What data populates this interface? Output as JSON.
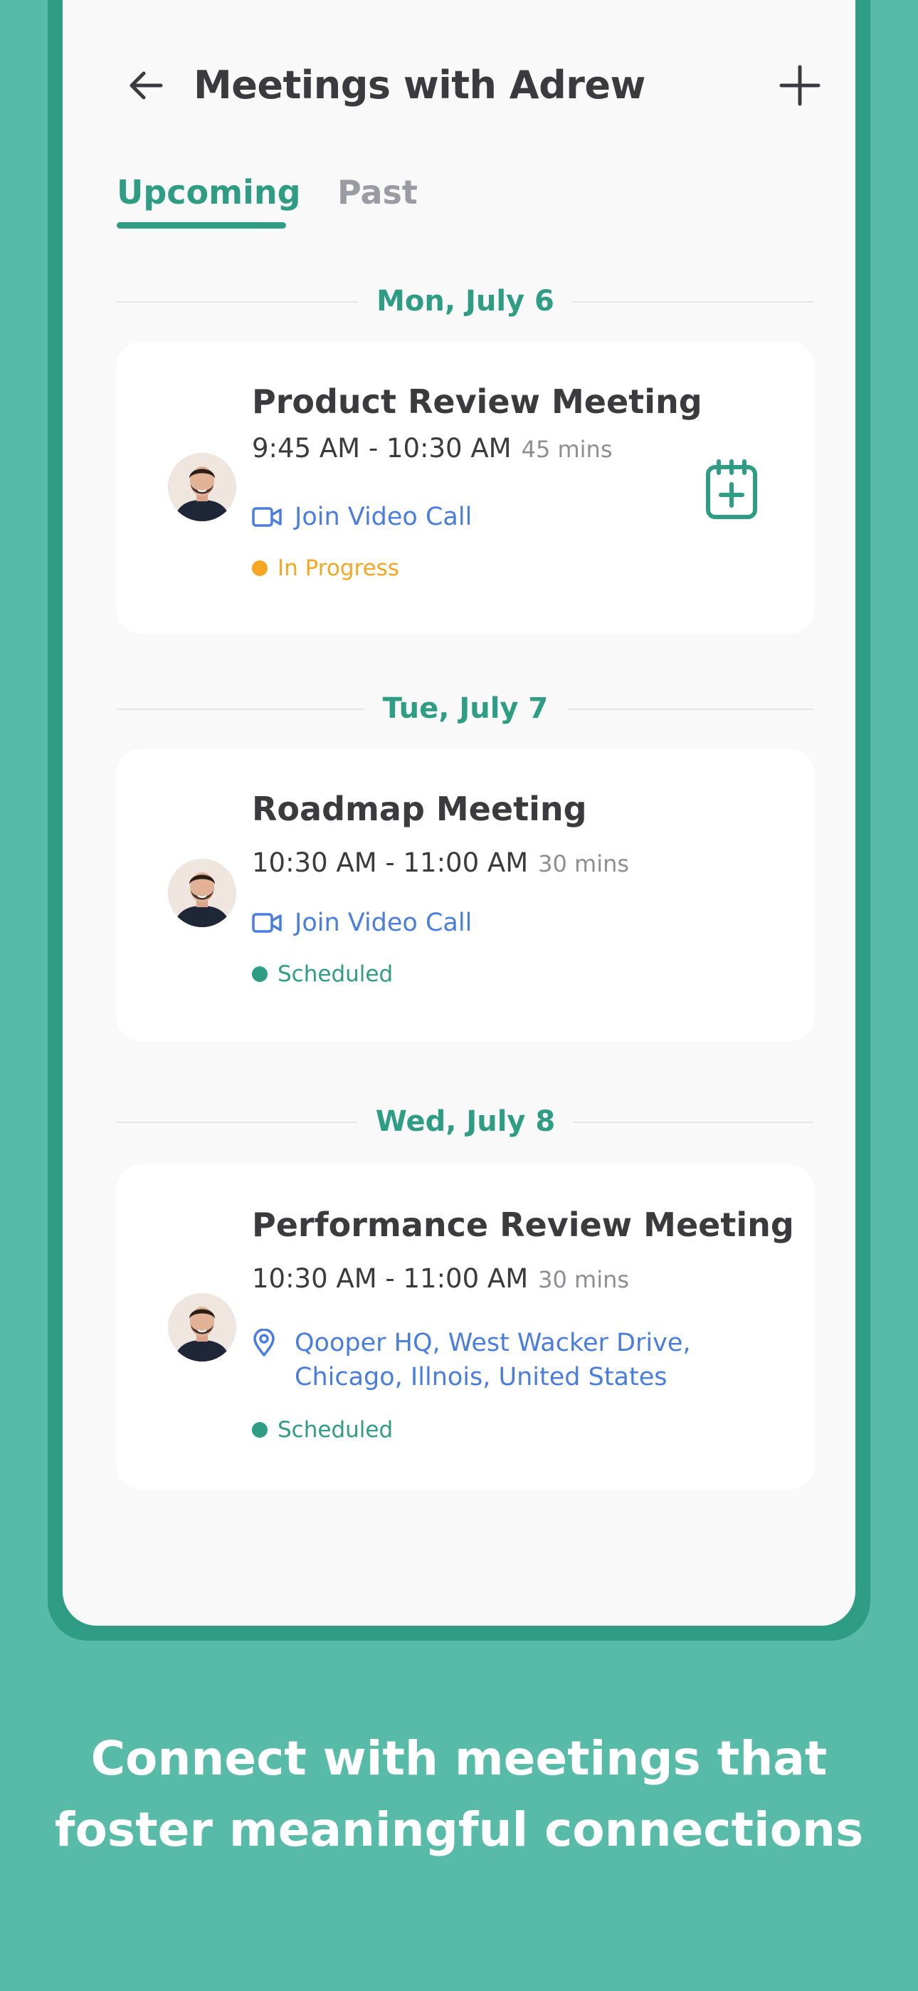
{
  "header": {
    "title": "Meetings with Adrew",
    "back_icon": "arrow-left-icon",
    "add_icon": "plus-icon"
  },
  "tabs": [
    {
      "label": "Upcoming",
      "active": true
    },
    {
      "label": "Past",
      "active": false
    }
  ],
  "colors": {
    "accent": "#2e9d83",
    "background": "#57bba7",
    "link": "#4a7de0",
    "in_progress": "#f5a623",
    "scheduled": "#2e9d83"
  },
  "meetings": [
    {
      "date": "Mon, July 6",
      "title": "Product Review Meeting",
      "time": "9:45 AM - 10:30 AM",
      "duration": "45 mins",
      "link_type": "video",
      "link_text": "Join Video Call",
      "status": "In Progress",
      "status_color": "#f5a623",
      "action_icon": "calendar-add-icon"
    },
    {
      "date": "Tue, July 7",
      "title": "Roadmap Meeting",
      "time": "10:30 AM - 11:00 AM",
      "duration": "30 mins",
      "link_type": "video",
      "link_text": "Join Video Call",
      "status": "Scheduled",
      "status_color": "#2e9d83"
    },
    {
      "date": "Wed, July 8",
      "title": "Performance Review Meeting",
      "time": "10:30 AM - 11:00 AM",
      "duration": "30 mins",
      "link_type": "location",
      "location_line1": "Qooper HQ, West Wacker Drive,",
      "location_line2": "Chicago, Illnois, United States",
      "status": "Scheduled",
      "status_color": "#2e9d83"
    }
  ],
  "caption": {
    "line1": "Connect with meetings that",
    "line2": "foster meaningful connections"
  }
}
